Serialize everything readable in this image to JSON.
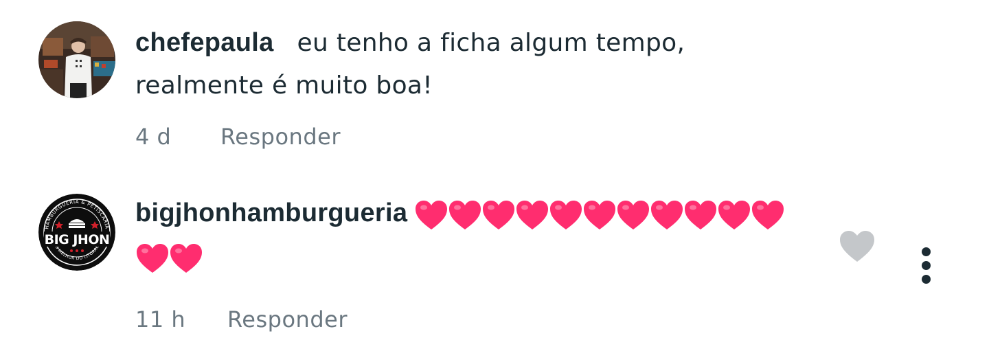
{
  "comments": [
    {
      "username": "chefepaula",
      "text_line1": "eu tenho a ficha algum tempo,",
      "text_line2": "realmente é muito boa!",
      "time": "4 d",
      "reply_label": "Responder",
      "avatar_icon": "chef-photo-avatar"
    },
    {
      "username": "bigjhonhamburgueria",
      "hearts_line1": 11,
      "hearts_line2": 2,
      "heart_icon": "pink-heart-emoji",
      "heart_color": "#ff2d6f",
      "time": "11 h",
      "reply_label": "Responder",
      "avatar_icon": "big-jhon-logo-avatar",
      "logo": {
        "top_text": "HAMBURGUERIA & PETISCARIA",
        "name": "BIG JHON",
        "bottom_text": "O MELHOR DO LITORAL"
      },
      "like_icon": "heart-outline-icon",
      "like_color": "#c4c7ca",
      "more_icon": "vertical-ellipsis-icon"
    }
  ]
}
